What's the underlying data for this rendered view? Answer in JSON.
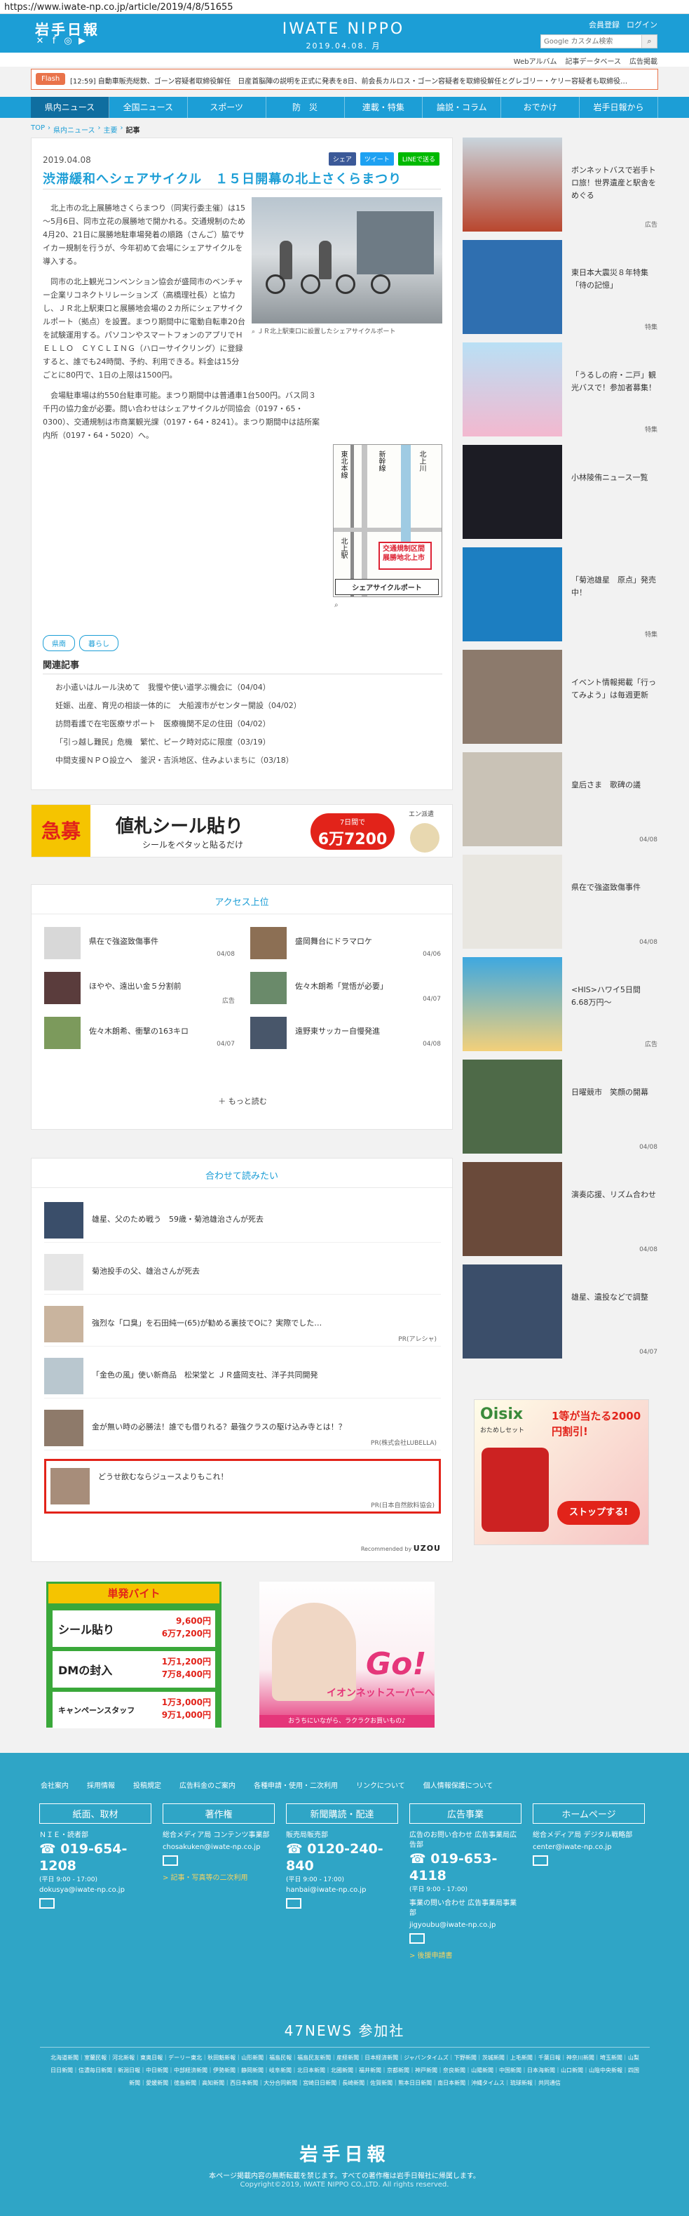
{
  "url": "https://www.iwate-np.co.jp/article/2019/4/8/51655",
  "header": {
    "logo": "岩手日報",
    "brand": "IWATE NIPPO",
    "date": "2019.04.08. 月",
    "member_links": [
      "会員登録",
      "ログイン"
    ],
    "search_placeholder": "Google カスタム検索",
    "sub_links": [
      "Webアルバム",
      "記事データベース",
      "広告掲載"
    ]
  },
  "flash": {
    "label": "Flash",
    "text": "[12:59] 自動車販売総数、ゴーン容疑者取締役解任　日産首脳陣の説明を正式に発表を8日、前会長カルロス・ゴーン容疑者を取締役解任とグレゴリー・ケリー容疑者も取締役…"
  },
  "nav": {
    "items": [
      "県内ニュース",
      "全国ニュース",
      "スポーツ",
      "防　災",
      "連載・特集",
      "論説・コラム",
      "おでかけ",
      "岩手日報から"
    ]
  },
  "breadcrumb": [
    "TOP",
    "県内ニュース",
    "主要",
    "記事"
  ],
  "article": {
    "date": "2019.04.08",
    "share": [
      "シェア",
      "ツイート",
      "LINEで送る"
    ],
    "title": "渋滞緩和へシェアサイクル　１５日開幕の北上さくらまつり",
    "paragraphs": [
      "北上市の北上展勝地さくらまつり（同実行委主催）は15～5月6日、同市立花の展勝地で開かれる。交通規制のため4月20、21日に展勝地駐車場発着の順路（さんご）脇でサイカー規制を行うが、今年初めて会場にシェアサイクルを導入する。",
      "同市の北上観光コンベンション協会が盛岡市のベンチャー企業リコネクトリレーションズ（高橋理社長）と協力し、ＪＲ北上駅東口と展勝地会場の２カ所にシェアサイクルポート（拠点）を設置。まつり期間中に電動自転車20台を試験運用する。パソコンやスマートフォンのアプリでＨＥＬＬＯ　ＣＹＣＬＩＮＧ（ハローサイクリング）に登録すると、誰でも24時間、予約、利用できる。料金は15分ごとに80円で、1日の上限は1500円。",
      "会場駐車場は約550台駐車可能。まつり期間中は普通車1台500円。バス同３千円の協力金が必要。問い合わせはシェアサイクルが同協会（0197・65・0300）、交通規制は市商業観光課（0197・64・8241）。まつり期間中は詰所案内所（0197・64・5020）へ。"
    ],
    "photo_caption": "ＪＲ北上駅東口に設置したシェアサイクルポート",
    "map": {
      "labels": [
        "展勝地",
        "北上川",
        "北上市",
        "北上駅",
        "新幹線",
        "東北本線"
      ],
      "box": "交通規制区間展勝地北上市",
      "bottom": "シェアサイクルポート"
    },
    "tags": [
      "県南",
      "暮らし"
    ],
    "related_title": "関連記事",
    "related": [
      "お小遣いはルール決めて　我慢や使い道学ぶ機会に（04/04）",
      "妊娠、出産、育児の相談一体的に　大船渡市がセンター開設（04/02）",
      "訪問看護で在宅医療サポート　医療機関不足の住田（04/02）",
      "「引っ越し難民」危機　繁忙、ピーク時対応に限度（03/19）",
      "中間支援ＮＰＯ設立へ　釜沢・吉浜地区、住みよいまちに（03/18）"
    ]
  },
  "banner1": {
    "badge": "急募",
    "title": "値札シール貼り",
    "sub": "シールをペタッと貼るだけ",
    "price_label": "7日間で",
    "price": "6万7200円",
    "brand": "エン派遣"
  },
  "access": {
    "title": "アクセス上位",
    "items": [
      {
        "title": "県在で強盗致傷事件",
        "date": "04/08"
      },
      {
        "title": "盛岡舞台にドラマロケ",
        "date": "04/06"
      },
      {
        "title": "ほやや、遠出い金５分割前",
        "date": "広告"
      },
      {
        "title": "佐々木朗希「覚悟が必要」",
        "date": "04/07"
      },
      {
        "title": "佐々木朗希、衝撃の163キロ",
        "date": "04/07"
      },
      {
        "title": "遠野東サッカー自慢発進",
        "date": "04/08"
      }
    ],
    "more": "もっと読む"
  },
  "together": {
    "title": "合わせて読みたい",
    "items": [
      {
        "title": "雄星、父のため戦う　59歳・菊池雄治さんが死去",
        "pr": ""
      },
      {
        "title": "菊池投手の父、雄治さんが死去",
        "pr": ""
      },
      {
        "title": "強烈な「口臭」を石田純一(65)が勧める裏技でOに？実際でした…",
        "pr": "PR(アレシャ)"
      },
      {
        "title": "「金色の風」使い新商品　松栄堂と ＪＲ盛岡支社、洋子共同開発",
        "pr": ""
      },
      {
        "title": "金が無い時の必勝法！誰でも借りれる？最強クラスの駆け込み寺とは！？",
        "pr": "PR(株式会社LUBELLA)"
      },
      {
        "title": "どうせ飲むならジュースよりもこれ！",
        "pr": "PR(日本自然飲料協会)"
      }
    ],
    "recommended_by": "Recommended by",
    "uzou": "UZOU"
  },
  "bannerL": {
    "header": "単発バイト",
    "rows": [
      {
        "job": "シール貼り",
        "p1": "9,600円",
        "p2": "6万7,200円"
      },
      {
        "job": "DMの封入",
        "p1": "1万1,200円",
        "p2": "7万8,400円"
      },
      {
        "job": "キャンペーンスタッフ",
        "p1": "1万3,000円",
        "p2": "9万1,000円"
      }
    ]
  },
  "bannerR": {
    "go": "Go!",
    "aeon": "イオンネットスーパーへ",
    "foot": "おうちにいながら、ラクラクお買いもの♪"
  },
  "side": {
    "items": [
      {
        "title": "ボンネットバスで岩手トロ旅！世界遺産と駅舎をめぐる",
        "tag": "広告"
      },
      {
        "title": "東日本大震災８年特集「待の記憶」",
        "tag": "特集"
      },
      {
        "title": "「うるしの府・二戸」観光バスで！参加者募集！",
        "tag": "特集"
      },
      {
        "title": "小林陵侑ニュース一覧",
        "tag": ""
      },
      {
        "title": "「菊池雄星　原点」発売中！",
        "tag": "特集"
      },
      {
        "title": "イベント情報掲載「行ってみよう」は毎週更新",
        "tag": ""
      },
      {
        "title": "皇后さま　歌碑の議",
        "tag": "04/08"
      },
      {
        "title": "県在で強盗致傷事件",
        "tag": "04/08"
      },
      {
        "title": "<HIS>ハワイ5日間6.68万円～",
        "tag": "広告"
      },
      {
        "title": "日曜競市　笑顔の開幕",
        "tag": "04/08"
      },
      {
        "title": "演奏応援、リズム合わせ",
        "tag": "04/08"
      },
      {
        "title": "雄星、遺投などで調整",
        "tag": "04/07"
      }
    ]
  },
  "side_ad": {
    "brand": "Oisix",
    "sub": "おためしセット",
    "headline": "1等が当たる2000円割引!",
    "button": "ストップする!"
  },
  "footer": {
    "links": [
      "会社案内",
      "採用情報",
      "投稿規定",
      "広告料金のご案内",
      "各種申請・使用・二次利用",
      "リンクについて",
      "個人情報保護について"
    ],
    "cols": [
      {
        "head": "紙面、取材",
        "line1": "ＮＩＥ・読者部",
        "tel": "019-654-1208",
        "hours": "(平日 9:00 - 17:00)",
        "mail": "dokusya@iwate-np.co.jp",
        "link": ""
      },
      {
        "head": "著作権",
        "line1": "総合メディア局 コンテンツ事業部",
        "tel": "",
        "hours": "",
        "mail": "chosakuken@iwate-np.co.jp",
        "link": "> 記事・写真等の二次利用"
      },
      {
        "head": "新聞購読・配達",
        "line1": "販売局販売部",
        "tel": "0120-240-840",
        "hours": "(平日 9:00 - 17:00)",
        "mail": "hanbai@iwate-np.co.jp",
        "link": ""
      },
      {
        "head": "広告事業",
        "line1": "広告のお問い合わせ 広告事業局広告部",
        "tel": "019-653-4118",
        "hours": "(平日 9:00 - 17:00)",
        "mail": "jigyoubu@iwate-np.co.jp",
        "link": "> 後援申請書"
      },
      {
        "head": "ホームページ",
        "line1": "総合メディア局 デジタル戦略部",
        "tel": "",
        "hours": "",
        "mail": "center@iwate-np.co.jp",
        "link": ""
      }
    ],
    "extra_line": "事業の問い合わせ 広告事業局事業部",
    "news47": "47NEWS 参加社",
    "papers": "北海道新聞｜室蘭民報｜河北新報｜東奥日報｜デーリー東北｜秋田魁新報｜山形新聞｜福島民報｜福島民友新聞｜産経新聞｜日本経済新聞｜ジャパンタイムズ｜下野新聞｜茨城新聞｜上毛新聞｜千葉日報｜神奈川新聞｜埼玉新聞｜山梨日日新聞｜信濃毎日新聞｜新潟日報｜中日新聞｜中部経済新聞｜伊勢新聞｜静岡新聞｜岐阜新聞｜北日本新聞｜北國新聞｜福井新聞｜京都新聞｜神戸新聞｜奈良新聞｜山陽新聞｜中国新聞｜日本海新聞｜山口新聞｜山陰中央新報｜四国新聞｜愛媛新聞｜徳島新聞｜高知新聞｜西日本新聞｜大分合同新聞｜宮崎日日新聞｜長崎新聞｜佐賀新聞｜熊本日日新聞｜南日本新聞｜沖縄タイムス｜琉球新報｜共同通信",
    "logo": "岩手日報",
    "note": "本ページ掲載内容の無断転載を禁じます。すべての著作権は岩手日報社に帰属します。",
    "copyright": "Copyright©2019, IWATE NIPPO CO.,LTD. All rights reserved."
  }
}
